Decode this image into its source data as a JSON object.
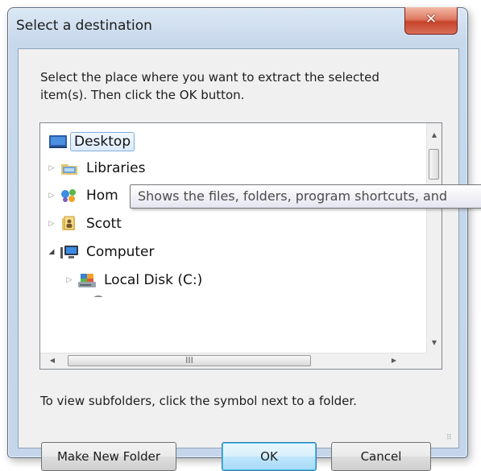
{
  "window": {
    "title": "Select a destination",
    "close_symbol": "✕"
  },
  "instructions": "Select the place where you want to extract the selected item(s).  Then click the OK button.",
  "tree": {
    "items": [
      {
        "label": "Desktop",
        "icon": "desktop-icon",
        "selected": true
      },
      {
        "label": "Libraries",
        "icon": "libraries-icon",
        "expander": "collapsed"
      },
      {
        "label": "Hom",
        "icon": "homegroup-icon",
        "expander": "collapsed"
      },
      {
        "label": "Scott",
        "icon": "user-folder-icon",
        "expander": "collapsed"
      },
      {
        "label": "Computer",
        "icon": "computer-icon",
        "expander": "expanded"
      },
      {
        "label": "Local Disk (C:)",
        "icon": "local-disk-icon",
        "expander": "collapsed"
      }
    ]
  },
  "tooltip": "Shows the files, folders, program shortcuts, and",
  "scrollbar": {
    "h_thumb_grip": "III"
  },
  "hint": "To view subfolders, click the symbol next to a folder.",
  "buttons": {
    "make_new_folder": "Make New Folder",
    "ok": "OK",
    "cancel": "Cancel"
  },
  "colors": {
    "title_bar": "#c7d8eb",
    "close_button": "#c6432a",
    "selection": "#dcebfc",
    "default_button": "#3c7fb1"
  }
}
